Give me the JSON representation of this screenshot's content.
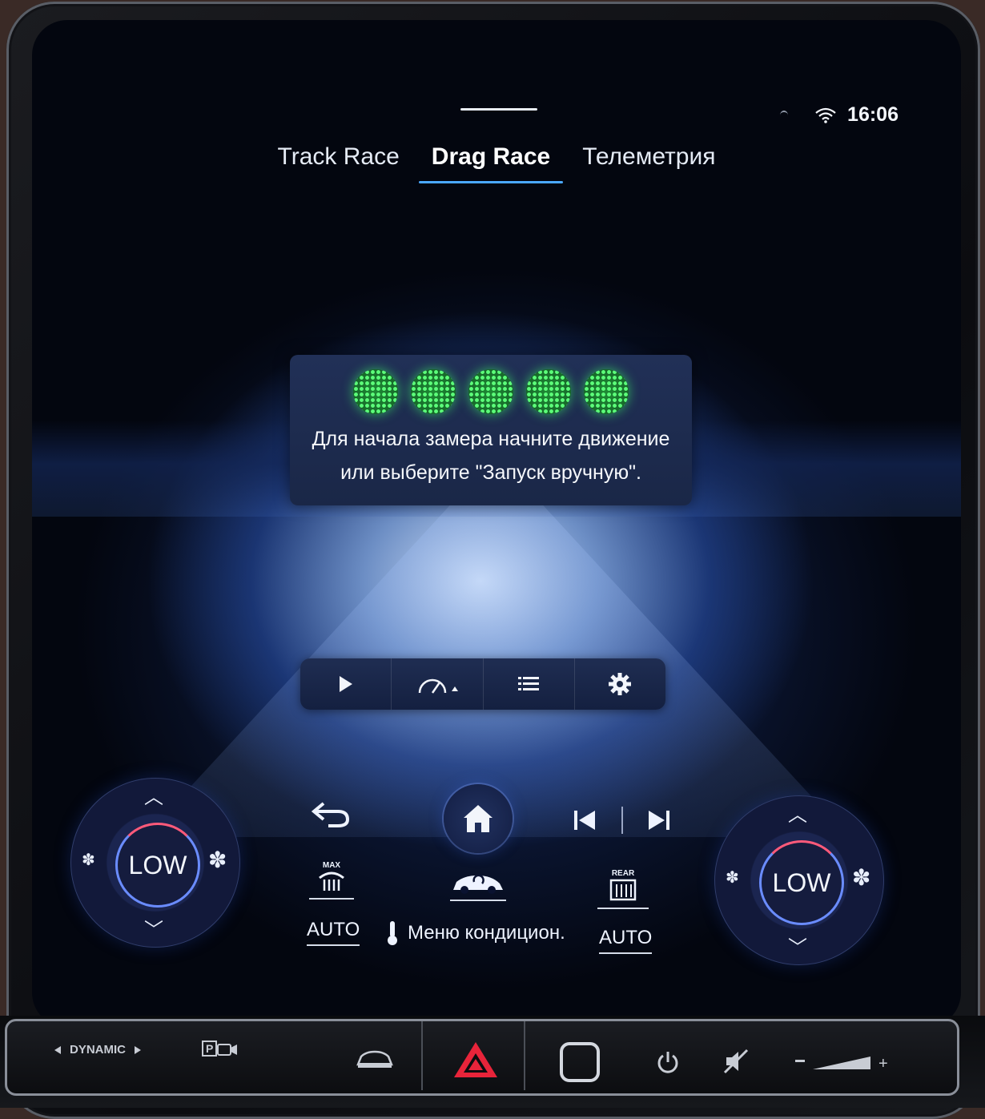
{
  "status": {
    "time": "16:06",
    "wifi_icon": "wifi-icon"
  },
  "tabs": [
    {
      "label": "Track Race",
      "active": false
    },
    {
      "label": "Drag Race",
      "active": true
    },
    {
      "label": "Телеметрия",
      "active": false
    }
  ],
  "message": {
    "line1": "Для начала замера начните движение",
    "line2": "или выберите \"Запуск вручную\".",
    "lights_count": 5,
    "light_color": "#3cff64"
  },
  "controls": [
    "play-icon",
    "speedometer-icon",
    "list-icon",
    "gear-icon"
  ],
  "climate": {
    "left_fan": "LOW",
    "right_fan": "LOW",
    "max_label": "MAX",
    "rear_label": "REAR",
    "left_auto": "AUTO",
    "right_auto": "AUTO",
    "menu_label": "Меню кондицион."
  },
  "hardware": {
    "drive_mode": "DYNAMIC",
    "parking_label": "P"
  },
  "colors": {
    "accent": "#4aa8ff",
    "hazard": "#e8243a"
  }
}
